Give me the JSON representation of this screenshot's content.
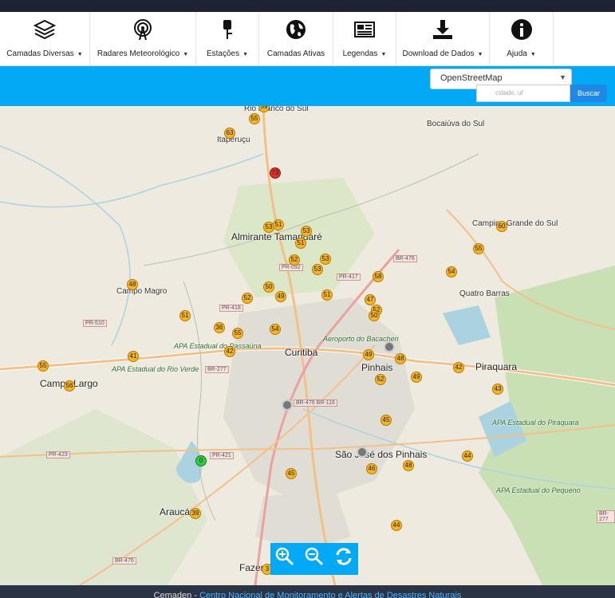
{
  "toolbar": {
    "items": [
      {
        "label": "Camadas Diversas",
        "icon": "layers-icon"
      },
      {
        "label": "Radares Meteorológico",
        "icon": "radar-icon"
      },
      {
        "label": "Estações",
        "icon": "station-icon"
      },
      {
        "label": "Camadas Ativas",
        "icon": "globe-icon"
      },
      {
        "label": "Legendas",
        "icon": "legend-icon"
      },
      {
        "label": "Download de Dados",
        "icon": "download-icon"
      },
      {
        "label": "Ajuda",
        "icon": "info-icon"
      }
    ]
  },
  "controls": {
    "layer_select": "OpenStreetMap",
    "search_placeholder": "cidade, uf",
    "search_button": "Buscar"
  },
  "map": {
    "places": [
      {
        "text": "Rio Branco do Sul",
        "cls": ""
      },
      {
        "text": "Itaperuçu",
        "cls": ""
      },
      {
        "text": "Bocaiúva do Sul",
        "cls": ""
      },
      {
        "text": "Almirante Tamandaré",
        "cls": "big"
      },
      {
        "text": "Campina Grande do Sul",
        "cls": ""
      },
      {
        "text": "Quatro Barras",
        "cls": ""
      },
      {
        "text": "Campo Magro",
        "cls": ""
      },
      {
        "text": "Curitiba",
        "cls": "big"
      },
      {
        "text": "Pinhais",
        "cls": "big"
      },
      {
        "text": "Piraquara",
        "cls": "big"
      },
      {
        "text": "Campo Largo",
        "cls": "big"
      },
      {
        "text": "São José dos Pinhais",
        "cls": "big"
      },
      {
        "text": "Araucária",
        "cls": "big"
      },
      {
        "text": "Fazenda Rio Grande",
        "cls": "big"
      },
      {
        "text": "APA Estadual do Passaúna",
        "cls": "green"
      },
      {
        "text": "APA Estadual do Rio Verde",
        "cls": "green"
      },
      {
        "text": "APA Estadual do Piraquara",
        "cls": "green"
      },
      {
        "text": "APA Estadual do Pequeno",
        "cls": "green"
      },
      {
        "text": "Aeroporto do Bacacheri",
        "cls": "green"
      }
    ],
    "roads": [
      "BR-476",
      "PR-092",
      "PR-417",
      "PR-418",
      "PR-510",
      "BR-277",
      "BR-476 BR-116",
      "PR-423",
      "PR-421",
      "BR-476",
      "BR-277"
    ],
    "markers": [
      {
        "v": "59",
        "t": "y"
      },
      {
        "v": "55",
        "t": "y"
      },
      {
        "v": "63",
        "t": "y"
      },
      {
        "v": "73",
        "t": "r"
      },
      {
        "v": "53",
        "t": "y"
      },
      {
        "v": "51",
        "t": "y"
      },
      {
        "v": "53",
        "t": "y"
      },
      {
        "v": "51",
        "t": "y"
      },
      {
        "v": "52",
        "t": "y"
      },
      {
        "v": "53",
        "t": "y"
      },
      {
        "v": "53",
        "t": "y"
      },
      {
        "v": "60",
        "t": "y"
      },
      {
        "v": "55",
        "t": "y"
      },
      {
        "v": "54",
        "t": "y"
      },
      {
        "v": "58",
        "t": "y"
      },
      {
        "v": "48",
        "t": "y"
      },
      {
        "v": "50",
        "t": "y"
      },
      {
        "v": "49",
        "t": "y"
      },
      {
        "v": "52",
        "t": "y"
      },
      {
        "v": "51",
        "t": "y"
      },
      {
        "v": "47",
        "t": "y"
      },
      {
        "v": "52",
        "t": "y"
      },
      {
        "v": "50",
        "t": "y"
      },
      {
        "v": "51",
        "t": "y"
      },
      {
        "v": "36",
        "t": "y"
      },
      {
        "v": "55",
        "t": "y"
      },
      {
        "v": "54",
        "t": "y"
      },
      {
        "v": "42",
        "t": "y"
      },
      {
        "v": "41",
        "t": "y"
      },
      {
        "v": "55",
        "t": "y"
      },
      {
        "v": "56",
        "t": "y"
      },
      {
        "v": "49",
        "t": "y"
      },
      {
        "v": "48",
        "t": "y"
      },
      {
        "v": "49",
        "t": "y"
      },
      {
        "v": "52",
        "t": "y"
      },
      {
        "v": "42",
        "t": "y"
      },
      {
        "v": "43",
        "t": "y"
      },
      {
        "v": "45",
        "t": "y"
      },
      {
        "v": "0",
        "t": "g"
      },
      {
        "v": "45",
        "t": "y"
      },
      {
        "v": "46",
        "t": "y"
      },
      {
        "v": "48",
        "t": "y"
      },
      {
        "v": "44",
        "t": "y"
      },
      {
        "v": "39",
        "t": "y"
      },
      {
        "v": "44",
        "t": "y"
      },
      {
        "v": "3",
        "t": "y"
      },
      {
        "v": "",
        "t": "k"
      },
      {
        "v": "",
        "t": "k"
      },
      {
        "v": "",
        "t": "k"
      }
    ]
  },
  "zoom": {
    "in": "zoom-in-icon",
    "out": "zoom-out-icon",
    "refresh": "refresh-icon"
  },
  "footer": {
    "prefix": "Cemaden - ",
    "link": "Centro Nacional de Monitoramento e Alertas de Desastres Naturais"
  }
}
